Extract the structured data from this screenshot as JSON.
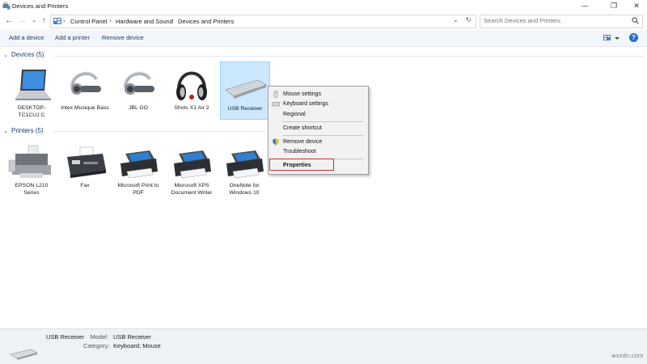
{
  "window": {
    "title": "Devices and Printers"
  },
  "address": {
    "crumbs": [
      "Control Panel",
      "Hardware and Sound",
      "Devices and Printers"
    ],
    "search_placeholder": "Search Devices and Printers"
  },
  "toolbar": {
    "add_device": "Add a device",
    "add_printer": "Add a printer",
    "remove_device": "Remove device"
  },
  "groups": {
    "devices": {
      "header": "Devices (5)",
      "items": [
        {
          "label": "DESKTOP-TC1CUJ C",
          "icon": "laptop-icon"
        },
        {
          "label": "Intex Musique Bass",
          "icon": "bluetooth-headset-icon"
        },
        {
          "label": "JBL GO",
          "icon": "bluetooth-headset-icon"
        },
        {
          "label": "Shots X1 Air 2",
          "icon": "headphones-icon"
        },
        {
          "label": "USB Receiver",
          "icon": "keyboard-icon"
        }
      ]
    },
    "printers": {
      "header": "Printers (5)",
      "items": [
        {
          "label": "EPSON L210 Series",
          "icon": "inkjet-printer-icon"
        },
        {
          "label": "Fax",
          "icon": "fax-icon"
        },
        {
          "label": "Microsoft Print to PDF",
          "icon": "printer-icon"
        },
        {
          "label": "Microsoft XPS Document Writer",
          "icon": "printer-icon"
        },
        {
          "label": "OneNote for Windows 10",
          "icon": "printer-icon"
        }
      ]
    }
  },
  "context_menu": {
    "items": [
      "Mouse settings",
      "Keyboard settings",
      "Regional",
      "Create shortcut",
      "Remove device",
      "Troubleshoot",
      "Properties"
    ]
  },
  "details": {
    "name": "USB Receiver",
    "model_label": "Model:",
    "model_value": "USB Receiver",
    "category_label": "Category:",
    "category_value": "Keyboard; Mouse"
  },
  "watermark": "wsxdn.com",
  "colors": {
    "accent": "#1e3a6e",
    "selection": "#cce8ff",
    "highlight": "#d9262d"
  }
}
